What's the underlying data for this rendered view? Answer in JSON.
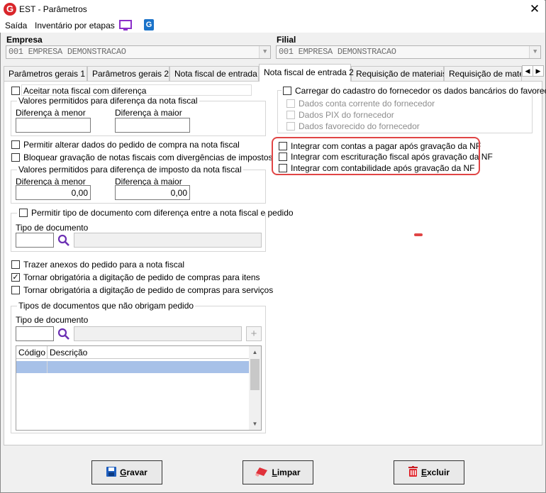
{
  "window": {
    "title": "EST - Parâmetros",
    "logo_letter": "G",
    "close": "✕"
  },
  "menu": {
    "saida": "Saída",
    "inventario": "Inventário por etapas"
  },
  "empresa": {
    "label": "Empresa",
    "value": "001 EMPRESA DEMONSTRACAO"
  },
  "filial": {
    "label": "Filial",
    "value": "001 EMPRESA DEMONSTRACAO"
  },
  "tabs": [
    "Parâmetros gerais 1",
    "Parâmetros gerais 2",
    "Nota fiscal de entrada",
    "Nota fiscal de entrada 2",
    "Requisição de materiais",
    "Requisição de materi"
  ],
  "left": {
    "aceitar": "Aceitar nota fiscal com diferença",
    "valores_nf": "Valores permitidos para diferença da nota fiscal",
    "dif_menor": "Diferença à menor",
    "dif_maior": "Diferença à maior",
    "permitir_alterar": "Permitir alterar dados do pedido de compra na nota fiscal",
    "bloquear": "Bloquear gravação de notas fiscais com divergências de impostos",
    "valores_imposto": "Valores permitidos para diferença de imposto da nota fiscal",
    "dif_menor2": "Diferença à menor",
    "dif_maior2": "Diferença à maior",
    "val_menor": "0,00",
    "val_maior": "0,00",
    "permitir_tipo": "Permitir tipo de documento com diferença entre a nota fiscal e pedido",
    "tipo_doc": "Tipo de documento",
    "trazer_anexos": "Trazer anexos do pedido para a nota fiscal",
    "obrig_itens": "Tornar obrigatória a digitação de pedido de compras para itens",
    "obrig_servicos": "Tornar obrigatória a digitação de pedido de compras para serviços",
    "tipos_nao_obrigam": "Tipos de documentos que não obrigam pedido",
    "tipo_doc2": "Tipo de documento",
    "col_codigo": "Código",
    "col_descricao": "Descrição"
  },
  "right": {
    "carregar": "Carregar do cadastro do fornecedor os dados bancários do favorecido",
    "conta": "Dados conta corrente do fornecedor",
    "pix": "Dados PIX do fornecedor",
    "favorecido": "Dados favorecido do fornecedor",
    "int_pagar": "Integrar com contas a pagar após gravação da NF",
    "int_escrit": "Integrar com escrituração fiscal após gravação da NF",
    "int_contab": "Integrar com contabilidade após gravação da NF"
  },
  "buttons": {
    "gravar_u": "G",
    "gravar": "ravar",
    "limpar_u": "L",
    "limpar": "impar",
    "excluir_u": "E",
    "excluir": "xcluir"
  },
  "colors": {
    "accent_red": "#e04545",
    "selection": "#a7c1e8",
    "icon_purple": "#8b2fc9",
    "icon_blue": "#1b73c9"
  }
}
